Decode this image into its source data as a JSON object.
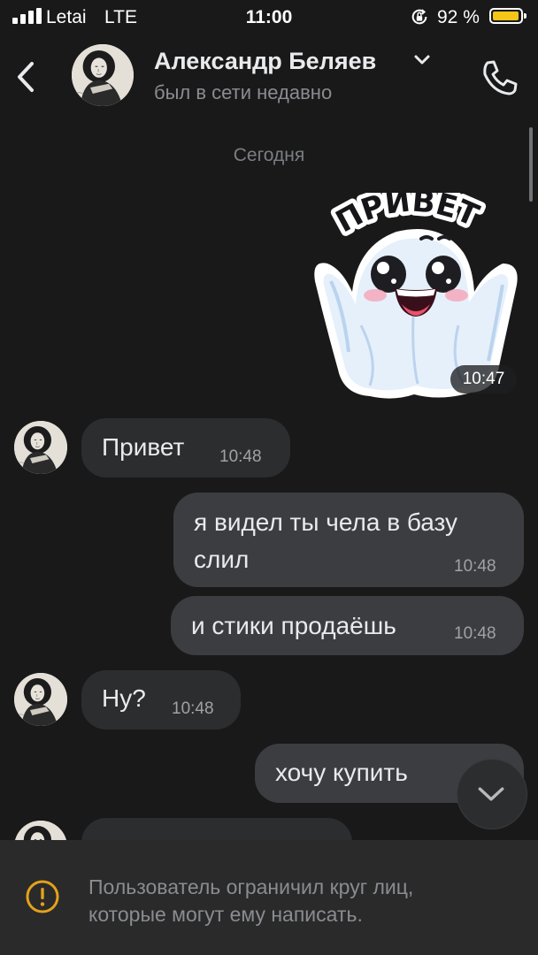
{
  "status_bar": {
    "carrier": "Letai",
    "network": "LTE",
    "time": "11:00",
    "battery_percent": "92 %",
    "battery_level": 0.92,
    "battery_color": "#f5c518"
  },
  "header": {
    "contact_name": "Александр Беляев",
    "contact_status": "был в сети недавно",
    "icons": {
      "back": "chevron-left-icon",
      "dropdown": "chevron-down-icon",
      "call": "phone-icon"
    }
  },
  "date_divider": "Сегодня",
  "sticker": {
    "caption": "ПРИВЕТ",
    "time": "10:47"
  },
  "messages": [
    {
      "direction": "incoming",
      "text": "Привет",
      "time": "10:48"
    },
    {
      "direction": "outgoing",
      "line1": "я видел ты чела в базу",
      "line2": "слил",
      "time": "10:48"
    },
    {
      "direction": "outgoing",
      "text": "и стики продаёшь",
      "time": "10:48"
    },
    {
      "direction": "incoming",
      "text": "Ну?",
      "time": "10:48"
    },
    {
      "direction": "outgoing",
      "text": "хочу купить",
      "time": ""
    }
  ],
  "scroll_down_icon": "chevron-down-icon",
  "restriction_notice": {
    "line1": "Пользователь ограничил круг лиц,",
    "line2": "которые могут ему написать.",
    "icon": "warning-icon",
    "icon_color": "#e3a21a"
  },
  "colors": {
    "background": "#19191a",
    "incoming_bubble": "#2c2d2f",
    "outgoing_bubble": "#3c3d40",
    "footer": "#2a2a2b"
  }
}
